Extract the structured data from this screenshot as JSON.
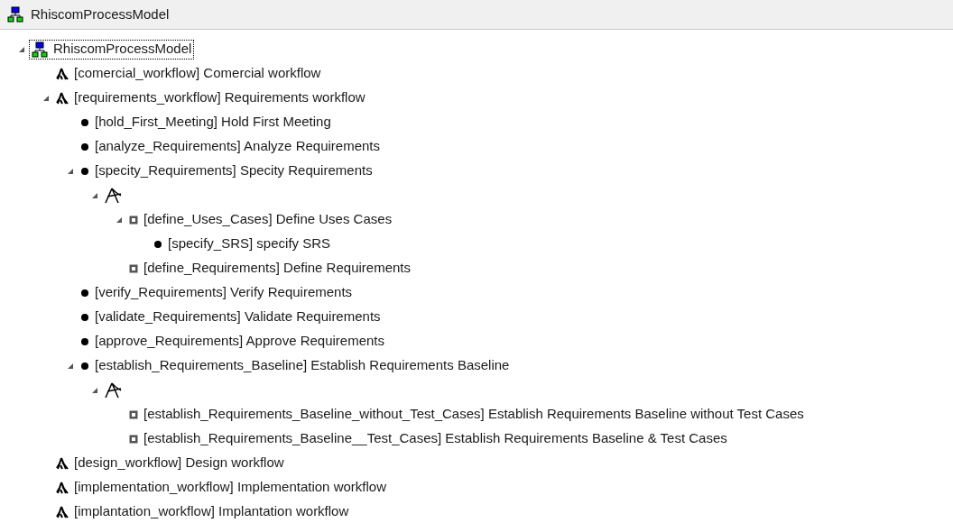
{
  "header": {
    "title": "RhiscomProcessModel"
  },
  "tree": [
    {
      "kind": "model",
      "label": "RhiscomProcessModel",
      "selected": true,
      "expanded": true,
      "children": [
        {
          "kind": "workflow",
          "label": "[comercial_workflow] Comercial workflow",
          "selected": false
        },
        {
          "kind": "workflow",
          "label": "[requirements_workflow] Requirements workflow",
          "selected": false,
          "expanded": true,
          "children": [
            {
              "kind": "activity",
              "label": "[hold_First_Meeting] Hold First Meeting",
              "selected": false
            },
            {
              "kind": "activity",
              "label": "[analyze_Requirements] Analyze Requirements",
              "selected": false
            },
            {
              "kind": "activity",
              "label": "[specity_Requirements] Specity Requirements",
              "selected": false,
              "expanded": true,
              "children": [
                {
                  "kind": "fork",
                  "selected": false,
                  "expanded": true,
                  "children": [
                    {
                      "kind": "task",
                      "label": "[define_Uses_Cases] Define Uses Cases",
                      "selected": false,
                      "expanded": true,
                      "children": [
                        {
                          "kind": "activity",
                          "label": "[specify_SRS] specify SRS",
                          "selected": false
                        }
                      ]
                    },
                    {
                      "kind": "task",
                      "label": "[define_Requirements] Define Requirements",
                      "selected": false
                    }
                  ]
                }
              ]
            },
            {
              "kind": "activity",
              "label": "[verify_Requirements] Verify Requirements",
              "selected": false
            },
            {
              "kind": "activity",
              "label": "[validate_Requirements] Validate Requirements",
              "selected": false
            },
            {
              "kind": "activity",
              "label": "[approve_Requirements] Approve Requirements",
              "selected": false
            },
            {
              "kind": "activity",
              "label": "[establish_Requirements_Baseline] Establish Requirements Baseline",
              "selected": false,
              "expanded": true,
              "children": [
                {
                  "kind": "fork",
                  "selected": false,
                  "expanded": true,
                  "children": [
                    {
                      "kind": "task",
                      "label": "[establish_Requirements_Baseline_without_Test_Cases] Establish Requirements Baseline without Test Cases",
                      "selected": false
                    },
                    {
                      "kind": "task",
                      "label": "[establish_Requirements_Baseline__Test_Cases] Establish Requirements Baseline & Test Cases",
                      "selected": false
                    }
                  ]
                }
              ]
            }
          ]
        },
        {
          "kind": "workflow",
          "label": "[design_workflow] Design workflow",
          "selected": false
        },
        {
          "kind": "workflow",
          "label": "[implementation_workflow] Implementation workflow",
          "selected": false
        },
        {
          "kind": "workflow",
          "label": "[implantation_workflow] Implantation workflow",
          "selected": false
        }
      ]
    }
  ]
}
